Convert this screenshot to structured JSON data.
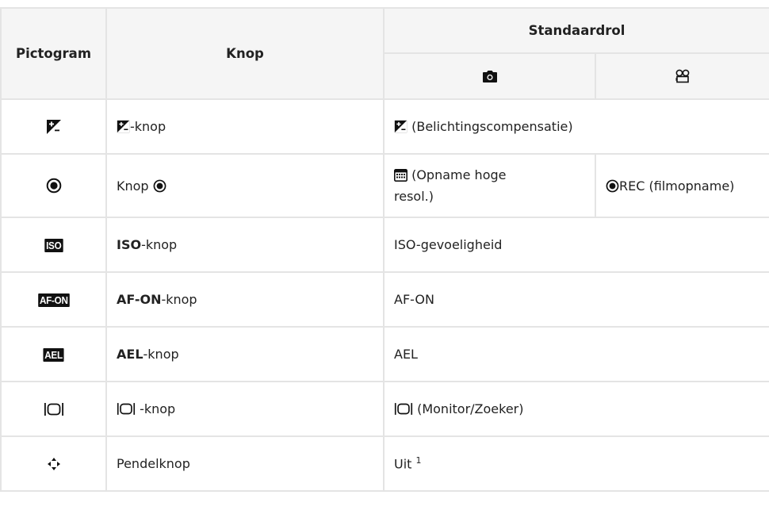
{
  "header": {
    "pictogram": "Pictogram",
    "knop": "Knop",
    "standaardrol": "Standaardrol"
  },
  "rows": [
    {
      "icon": "exposure-comp-icon",
      "knop_suffix": "-knop",
      "role": "(Belichtingscompensatie)"
    },
    {
      "icon": "record-icon",
      "knop_prefix": "Knop",
      "role_photo_line1": "(Opname hoge",
      "role_photo_line2": "resol.)",
      "role_video": "REC (filmopname)"
    },
    {
      "icon": "iso-icon",
      "badge": "ISO",
      "knop_bold": "ISO",
      "knop_suffix": "-knop",
      "role": "ISO-gevoeligheid"
    },
    {
      "icon": "af-on-icon",
      "badge": "AF-ON",
      "knop_bold": "AF-ON",
      "knop_suffix": "-knop",
      "role": "AF-ON"
    },
    {
      "icon": "ael-icon",
      "badge": "AEL",
      "knop_bold": "AEL",
      "knop_suffix": "-knop",
      "role": "AEL"
    },
    {
      "icon": "monitor-viewfinder-icon",
      "knop_suffix": " -knop",
      "role": "(Monitor/Zoeker)"
    },
    {
      "icon": "multi-selector-icon",
      "knop": "Pendelknop",
      "role": "Uit",
      "footnote": "1"
    }
  ]
}
